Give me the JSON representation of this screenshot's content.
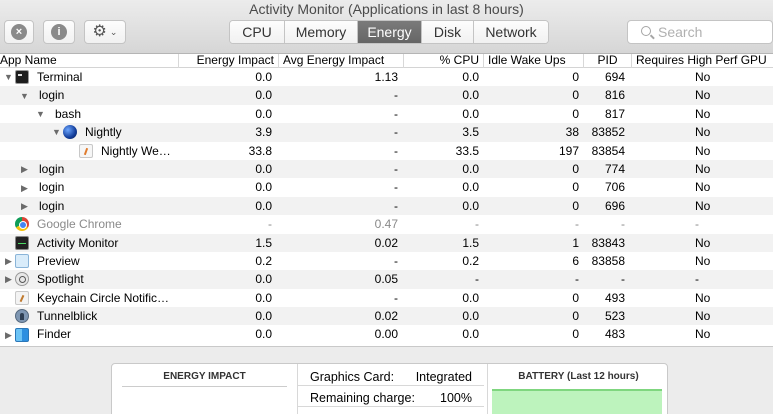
{
  "window": {
    "title": "Activity Monitor (Applications in last 8 hours)"
  },
  "toolbar": {
    "close_glyph": "×",
    "info_glyph": "i",
    "gear_glyph": "⚙",
    "chevron_glyph": "⌄",
    "tabs": [
      {
        "label": "CPU",
        "active": false
      },
      {
        "label": "Memory",
        "active": false
      },
      {
        "label": "Energy",
        "active": true
      },
      {
        "label": "Disk",
        "active": false
      },
      {
        "label": "Network",
        "active": false
      }
    ],
    "search": {
      "placeholder": "Search",
      "value": ""
    }
  },
  "icons": {
    "terminal": "terminal-icon",
    "nightly": "nightly-globe-icon",
    "nightly_web": "document-icon",
    "chrome": "chrome-icon",
    "activity_monitor": "activity-monitor-icon",
    "preview": "preview-icon",
    "spotlight": "spotlight-icon",
    "keychain": "keychain-icon",
    "tunnelblick": "tunnelblick-icon",
    "finder": "finder-icon"
  },
  "table": {
    "columns": [
      "App Name",
      "Energy Impact",
      "Avg Energy Impact",
      "% CPU",
      "Idle Wake Ups",
      "PID",
      "Requires High Perf GPU"
    ],
    "rows": [
      {
        "name": "Terminal",
        "depth": 0,
        "disclosure": "open",
        "icon": "terminal",
        "energy": "0.0",
        "avg": "1.13",
        "cpu": "0.0",
        "wakeups": "0",
        "pid": "694",
        "gpu": "No",
        "dim": false
      },
      {
        "name": "login",
        "depth": 1,
        "disclosure": "open",
        "icon": "",
        "energy": "0.0",
        "avg": "-",
        "cpu": "0.0",
        "wakeups": "0",
        "pid": "816",
        "gpu": "No",
        "dim": false
      },
      {
        "name": "bash",
        "depth": 2,
        "disclosure": "open",
        "icon": "",
        "energy": "0.0",
        "avg": "-",
        "cpu": "0.0",
        "wakeups": "0",
        "pid": "817",
        "gpu": "No",
        "dim": false
      },
      {
        "name": "Nightly",
        "depth": 3,
        "disclosure": "open",
        "icon": "nightly",
        "energy": "3.9",
        "avg": "-",
        "cpu": "3.5",
        "wakeups": "38",
        "pid": "83852",
        "gpu": "No",
        "dim": false
      },
      {
        "name": "Nightly We…",
        "depth": 4,
        "disclosure": "none",
        "icon": "nightly_web",
        "energy": "33.8",
        "avg": "-",
        "cpu": "33.5",
        "wakeups": "197",
        "pid": "83854",
        "gpu": "No",
        "dim": false
      },
      {
        "name": "login",
        "depth": 1,
        "disclosure": "closed",
        "icon": "",
        "energy": "0.0",
        "avg": "-",
        "cpu": "0.0",
        "wakeups": "0",
        "pid": "774",
        "gpu": "No",
        "dim": false
      },
      {
        "name": "login",
        "depth": 1,
        "disclosure": "closed",
        "icon": "",
        "energy": "0.0",
        "avg": "-",
        "cpu": "0.0",
        "wakeups": "0",
        "pid": "706",
        "gpu": "No",
        "dim": false
      },
      {
        "name": "login",
        "depth": 1,
        "disclosure": "closed",
        "icon": "",
        "energy": "0.0",
        "avg": "-",
        "cpu": "0.0",
        "wakeups": "0",
        "pid": "696",
        "gpu": "No",
        "dim": false
      },
      {
        "name": "Google Chrome",
        "depth": 0,
        "disclosure": "none",
        "icon": "chrome",
        "energy": "-",
        "avg": "0.47",
        "cpu": "-",
        "wakeups": "-",
        "pid": "-",
        "gpu": "-",
        "dim": true
      },
      {
        "name": "Activity Monitor",
        "depth": 0,
        "disclosure": "none",
        "icon": "activity_monitor",
        "energy": "1.5",
        "avg": "0.02",
        "cpu": "1.5",
        "wakeups": "1",
        "pid": "83843",
        "gpu": "No",
        "dim": false
      },
      {
        "name": "Preview",
        "depth": 0,
        "disclosure": "closed",
        "icon": "preview",
        "energy": "0.2",
        "avg": "-",
        "cpu": "0.2",
        "wakeups": "6",
        "pid": "83858",
        "gpu": "No",
        "dim": false
      },
      {
        "name": "Spotlight",
        "depth": 0,
        "disclosure": "closed",
        "icon": "spotlight",
        "energy": "0.0",
        "avg": "0.05",
        "cpu": "-",
        "wakeups": "-",
        "pid": "-",
        "gpu": "-",
        "dim": false
      },
      {
        "name": "Keychain Circle Notific…",
        "depth": 0,
        "disclosure": "none",
        "icon": "keychain",
        "energy": "0.0",
        "avg": "-",
        "cpu": "0.0",
        "wakeups": "0",
        "pid": "493",
        "gpu": "No",
        "dim": false
      },
      {
        "name": "Tunnelblick",
        "depth": 0,
        "disclosure": "none",
        "icon": "tunnelblick",
        "energy": "0.0",
        "avg": "0.02",
        "cpu": "0.0",
        "wakeups": "0",
        "pid": "523",
        "gpu": "No",
        "dim": false
      },
      {
        "name": "Finder",
        "depth": 0,
        "disclosure": "closed",
        "icon": "finder",
        "energy": "0.0",
        "avg": "0.00",
        "cpu": "0.0",
        "wakeups": "0",
        "pid": "483",
        "gpu": "No",
        "dim": false
      }
    ]
  },
  "summary": {
    "energy_impact_title": "ENERGY IMPACT",
    "graphics_card_label": "Graphics Card:",
    "graphics_card_value": "Integrated",
    "remaining_charge_label": "Remaining charge:",
    "remaining_charge_value": "100%",
    "battery_title": "BATTERY (Last 12 hours)"
  },
  "colors": {
    "active_tab": "#6f6f6f",
    "battery_fill": "#bdf3bd"
  }
}
